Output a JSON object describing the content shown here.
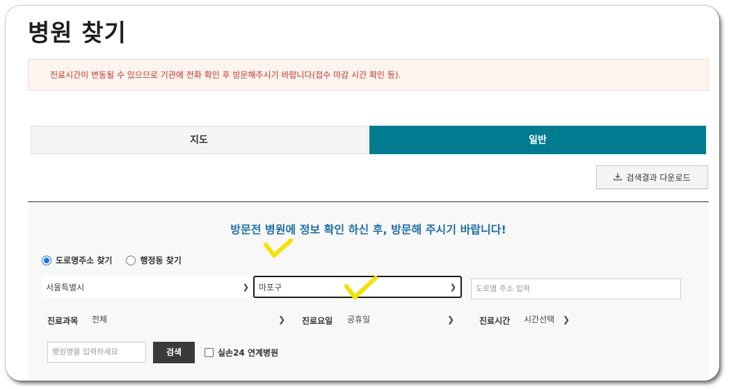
{
  "page": {
    "title": "병원 찾기"
  },
  "notice": {
    "text": "진료시간이 변동될 수 있으므로 기관에 전화 확인 후 방문해주시기 바랍니다(접수 마감 시간 확인 등)."
  },
  "tabs": [
    {
      "label": "지도",
      "active": false
    },
    {
      "label": "일반",
      "active": true
    }
  ],
  "download": {
    "label": "검색결과 다운로드",
    "icon": "download-icon"
  },
  "search": {
    "headline": "방문전 병원에 정보 확인 하신 후, 방문해 주시기 바랍니다!",
    "radio_road": "도로명주소 찾기",
    "radio_admin": "행정동 찾기",
    "city": "서울특별시",
    "district": "마포구",
    "road_placeholder": "도로명 주소 입력",
    "dept_label": "진료과목",
    "dept_value": "전체",
    "day_label": "진료요일",
    "day_value": "공휴일",
    "time_label": "진료시간",
    "time_value": "시간선택",
    "name_placeholder": "병원명을 입력하세요",
    "search_button": "검색",
    "checkbox_label": "실손24 연계병원"
  },
  "colors": {
    "accent": "#007b8f",
    "headline": "#1f6fa8",
    "notice_text": "#c0392b",
    "highlight": "#f5e100"
  }
}
